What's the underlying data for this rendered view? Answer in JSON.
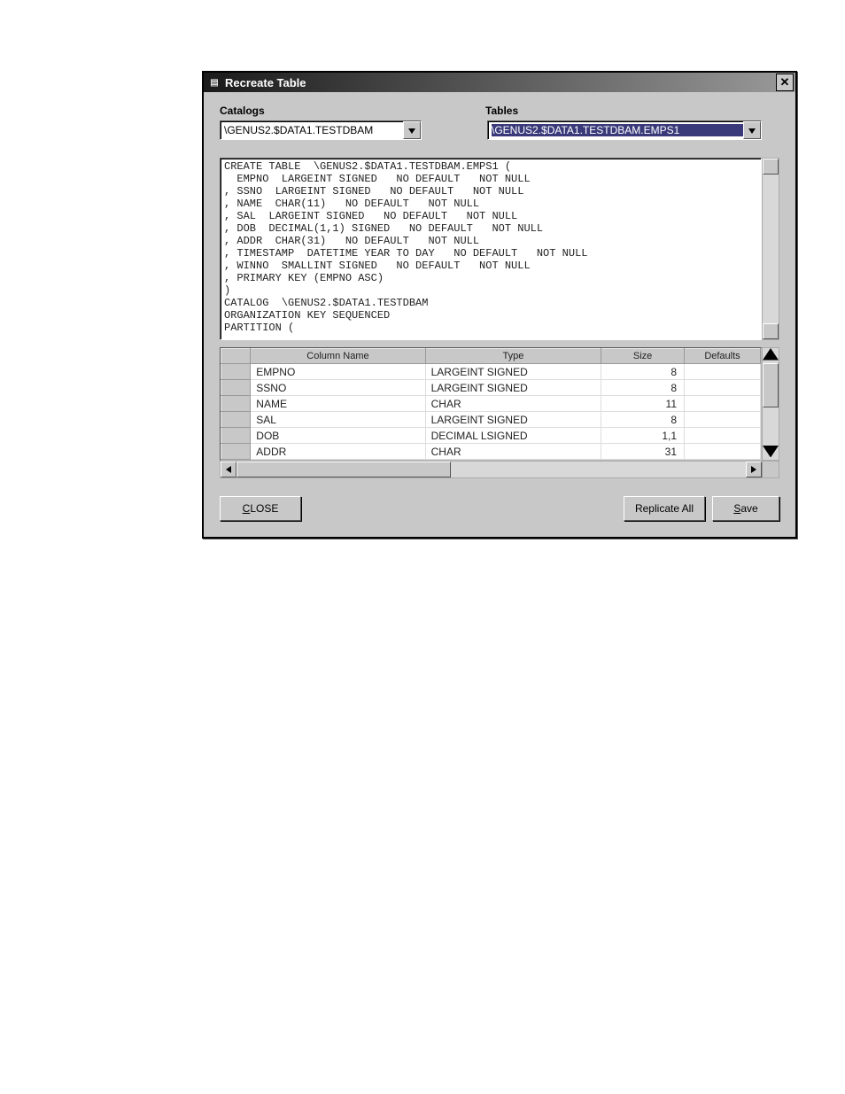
{
  "window": {
    "title": "Recreate Table"
  },
  "labels": {
    "catalogs": "Catalogs",
    "tables": "Tables"
  },
  "combos": {
    "catalogs_value": "\\GENUS2.$DATA1.TESTDBAM",
    "tables_value": "\\GENUS2.$DATA1.TESTDBAM.EMPS1"
  },
  "sql_text": "CREATE TABLE  \\GENUS2.$DATA1.TESTDBAM.EMPS1 (\n  EMPNO  LARGEINT SIGNED   NO DEFAULT   NOT NULL\n, SSNO  LARGEINT SIGNED   NO DEFAULT   NOT NULL\n, NAME  CHAR(11)   NO DEFAULT   NOT NULL\n, SAL  LARGEINT SIGNED   NO DEFAULT   NOT NULL\n, DOB  DECIMAL(1,1) SIGNED   NO DEFAULT   NOT NULL\n, ADDR  CHAR(31)   NO DEFAULT   NOT NULL\n, TIMESTAMP  DATETIME YEAR TO DAY   NO DEFAULT   NOT NULL\n, WINNO  SMALLINT SIGNED   NO DEFAULT   NOT NULL\n, PRIMARY KEY (EMPNO ASC)\n)\nCATALOG  \\GENUS2.$DATA1.TESTDBAM\nORGANIZATION KEY SEQUENCED\nPARTITION (",
  "grid": {
    "headers": {
      "col_name": "Column Name",
      "type": "Type",
      "size": "Size",
      "defaults": "Defaults"
    },
    "rows": [
      {
        "name": "EMPNO",
        "type": "LARGEINT SIGNED",
        "size": "8"
      },
      {
        "name": "SSNO",
        "type": "LARGEINT SIGNED",
        "size": "8"
      },
      {
        "name": "NAME",
        "type": "CHAR",
        "size": "11"
      },
      {
        "name": "SAL",
        "type": "LARGEINT SIGNED",
        "size": "8"
      },
      {
        "name": "DOB",
        "type": "DECIMAL LSIGNED",
        "size": "1,1"
      },
      {
        "name": "ADDR",
        "type": "CHAR",
        "size": "31"
      }
    ]
  },
  "buttons": {
    "close_u": "C",
    "close_rest": "LOSE",
    "replicate_all": "Replicate All",
    "save_u": "S",
    "save_rest": "ave"
  }
}
